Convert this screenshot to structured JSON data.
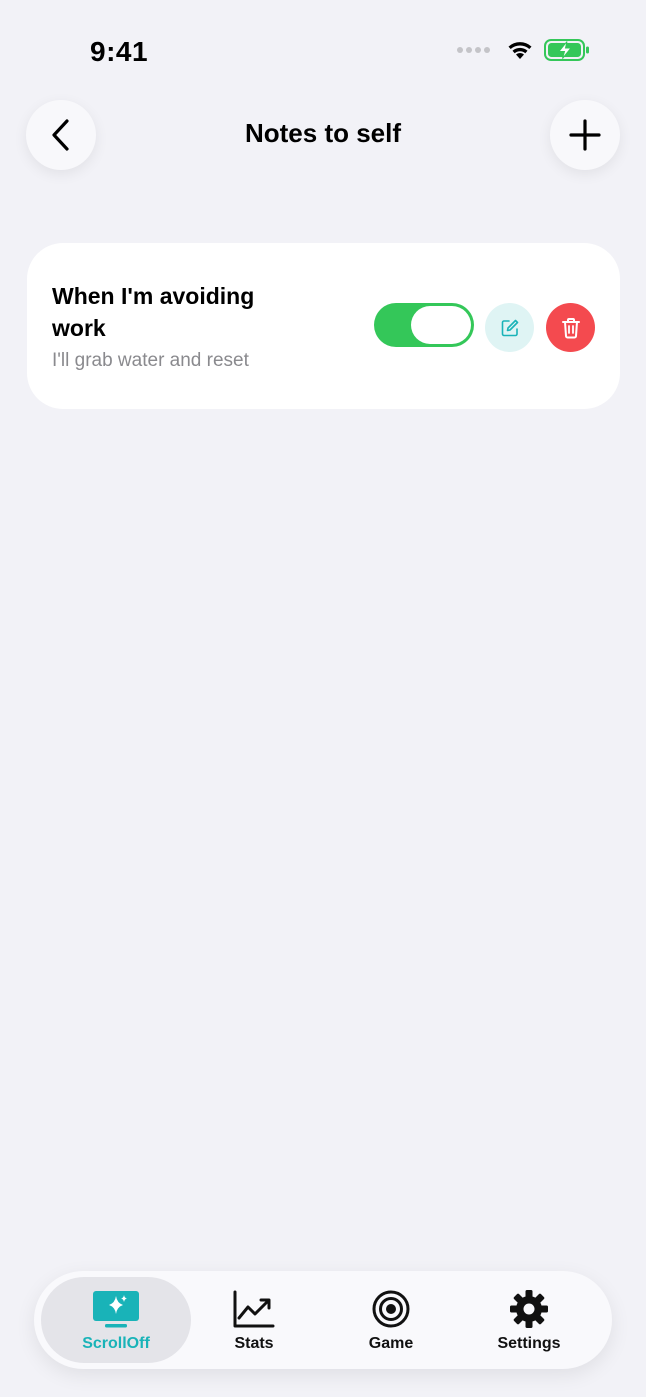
{
  "status_bar": {
    "time": "9:41"
  },
  "header": {
    "title": "Notes to self",
    "back_icon": "chevron-left-icon",
    "add_icon": "plus-icon"
  },
  "notes": [
    {
      "title": "When I'm avoiding work",
      "subtitle": "I'll grab water and reset",
      "enabled": true
    }
  ],
  "tab_bar": {
    "tabs": [
      {
        "label": "ScrollOff",
        "icon": "sparkle-monitor-icon",
        "active": true
      },
      {
        "label": "Stats",
        "icon": "chart-trend-icon",
        "active": false
      },
      {
        "label": "Game",
        "icon": "target-icon",
        "active": false
      },
      {
        "label": "Settings",
        "icon": "gear-icon",
        "active": false
      }
    ]
  },
  "colors": {
    "background": "#f2f2f7",
    "accent": "#19b3b8",
    "toggle_on": "#34c759",
    "delete": "#f44a4f",
    "battery": "#34c759"
  }
}
